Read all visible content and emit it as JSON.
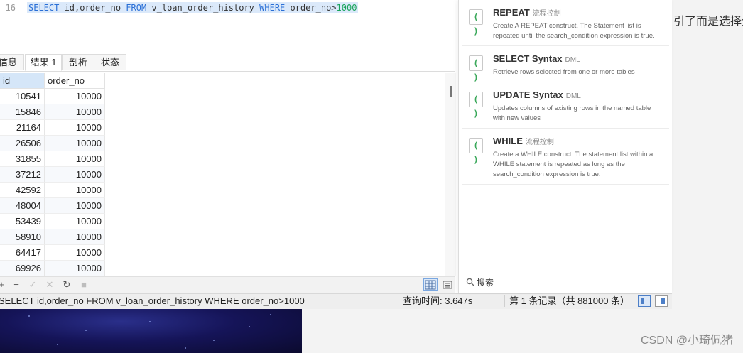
{
  "page": {
    "partial_text": "引了而是选择全",
    "watermark": "CSDN @小琦佩猪"
  },
  "editor": {
    "line_number": "16",
    "sql": {
      "kw1": "SELECT",
      "cols": " id,order_no ",
      "kw2": "FROM",
      "table": " v_loan_order_history ",
      "kw3": "WHERE",
      "cond": " order_no>",
      "num": "1000"
    }
  },
  "tabs": [
    {
      "label": "信息"
    },
    {
      "label": "结果 1",
      "active": true
    },
    {
      "label": "剖析"
    },
    {
      "label": "状态"
    }
  ],
  "grid": {
    "columns": [
      "id",
      "order_no"
    ],
    "rows": [
      [
        "10541",
        "10000"
      ],
      [
        "15846",
        "10000"
      ],
      [
        "21164",
        "10000"
      ],
      [
        "26506",
        "10000"
      ],
      [
        "31855",
        "10000"
      ],
      [
        "37212",
        "10000"
      ],
      [
        "42592",
        "10000"
      ],
      [
        "48004",
        "10000"
      ],
      [
        "53439",
        "10000"
      ],
      [
        "58910",
        "10000"
      ],
      [
        "64417",
        "10000"
      ],
      [
        "69926",
        "10000"
      ]
    ]
  },
  "toolbar": {
    "icons": [
      "add-icon",
      "delete-icon",
      "apply-icon",
      "discard-icon",
      "refresh-icon",
      "stop-icon"
    ]
  },
  "status": {
    "query": "SELECT id,order_no FROM v_loan_order_history WHERE order_no>1000",
    "time": "查询时间: 3.647s",
    "records": "第 1 条记录（共 881000 条）"
  },
  "suggestions": [
    {
      "title": "REPEAT",
      "tag": "流程控制",
      "desc": "Create A REPEAT construct. The Statement list is repeated until the search_condition expression is true."
    },
    {
      "title": "SELECT Syntax",
      "tag": "DML",
      "desc": "Retrieve rows selected from one or more tables"
    },
    {
      "title": "UPDATE Syntax",
      "tag": "DML",
      "desc": "Updates columns of existing rows in the named table with new values"
    },
    {
      "title": "WHILE",
      "tag": "流程控制",
      "desc": "Create a WHILE construct. The statement list within a WHILE statement is repeated as long as the search_condition expression is true."
    }
  ],
  "popup": {
    "search_label": "搜索"
  },
  "colors": {
    "keyword": "#2a6fd6",
    "number": "#19a35a",
    "selection": "#dbe9fa",
    "icon_green": "#3aa85a"
  }
}
